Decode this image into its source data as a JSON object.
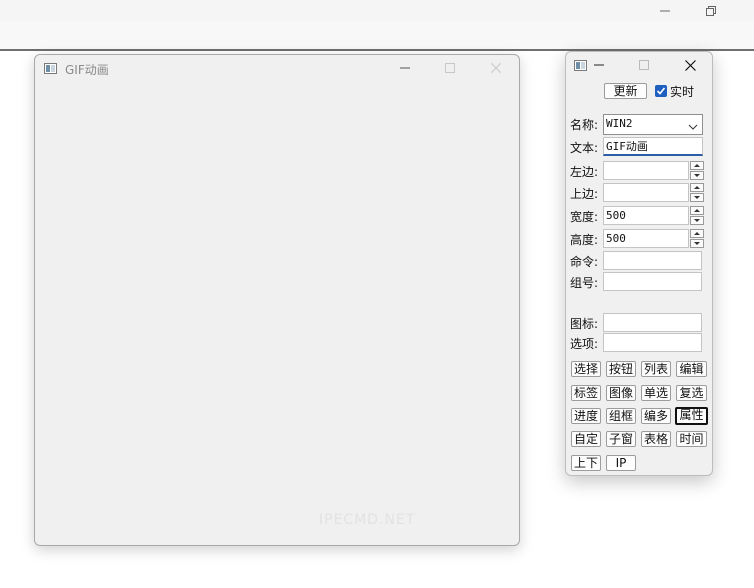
{
  "gif_window": {
    "title": "GIF动画",
    "watermark": "IPECMD.NET"
  },
  "panel": {
    "update_button": "更新",
    "realtime_label": "实时",
    "realtime_checked": true,
    "labels": {
      "name": "名称:",
      "text": "文本:",
      "left": "左边:",
      "top": "上边:",
      "width": "宽度:",
      "height": "高度:",
      "command": "命令:",
      "group": "组号:",
      "icon": "图标:",
      "options": "选项:"
    },
    "values": {
      "name": "WIN2",
      "text": "GIF动画",
      "left": "",
      "top": "",
      "width": "500",
      "height": "500",
      "command": "",
      "group": "",
      "icon": "",
      "options": ""
    },
    "buttons": {
      "select": "选择",
      "button": "按钮",
      "list": "列表",
      "edit": "编辑",
      "label": "标签",
      "image": "图像",
      "radio": "单选",
      "checkbox": "复选",
      "progress": "进度",
      "groupbox": "组框",
      "multiedit": "编多",
      "properties": "属性",
      "custom": "自定",
      "child_window": "子窗",
      "table": "表格",
      "time": "时间",
      "updown": "上下",
      "ip": "IP"
    },
    "selected_button": "属性"
  },
  "colors": {
    "accent": "#1f5fbf",
    "window_bg": "#f0f0f0"
  }
}
